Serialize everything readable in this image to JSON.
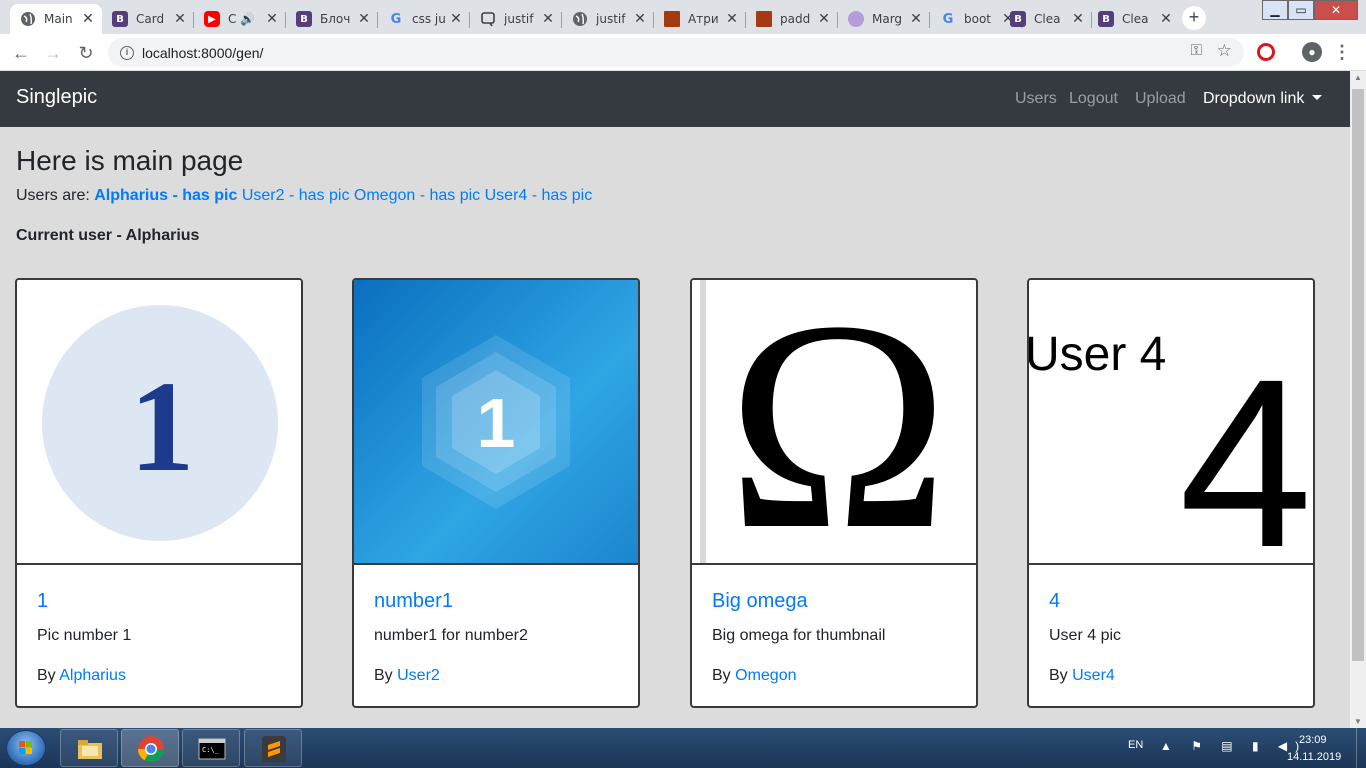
{
  "browser": {
    "tabs": [
      {
        "title": "Main",
        "icon": "globe-icon",
        "active": true
      },
      {
        "title": "Card",
        "icon": "bootstrap-icon"
      },
      {
        "title": "C",
        "icon": "youtube-icon",
        "audio": true
      },
      {
        "title": "Блоч",
        "icon": "bootstrap-icon"
      },
      {
        "title": "css ju",
        "icon": "google-icon"
      },
      {
        "title": "justif",
        "icon": "chat-icon"
      },
      {
        "title": "justif",
        "icon": "globe-icon"
      },
      {
        "title": "Атри",
        "icon": "stack-icon"
      },
      {
        "title": "padd",
        "icon": "stack-icon"
      },
      {
        "title": "Marg",
        "icon": "marg-icon"
      },
      {
        "title": "boot",
        "icon": "google-icon"
      },
      {
        "title": "Clea",
        "icon": "bootstrap-icon"
      },
      {
        "title": "Clea",
        "icon": "bootstrap-icon"
      }
    ],
    "tab_close": "✕",
    "new_tab": "+",
    "url": "localhost:8000/gen/",
    "back": "←",
    "forward": "→",
    "reload": "↻",
    "key_icon": "⚿",
    "star": "☆",
    "menu": "⋮"
  },
  "site": {
    "brand": "Singlepic",
    "nav": {
      "users": "Users",
      "logout": "Logout",
      "upload": "Upload",
      "dropdown": "Dropdown link"
    },
    "title": "Here is main page",
    "users_prefix": "Users are:",
    "users": [
      {
        "label": "Alpharius - has pic",
        "current": true
      },
      {
        "label": "User2 - has pic",
        "current": false
      },
      {
        "label": "Omegon - has pic",
        "current": false
      },
      {
        "label": "User4 - has pic",
        "current": false
      }
    ],
    "current_user": "Current user - Alpharius",
    "cards": [
      {
        "title": "1",
        "text": "Pic number 1",
        "by_label": "By",
        "author": "Alpharius",
        "image_glyph": "1"
      },
      {
        "title": "number1",
        "text": "number1 for number2",
        "by_label": "By",
        "author": "User2",
        "image_glyph": "1"
      },
      {
        "title": "Big omega",
        "text": "Big omega for thumbnail",
        "by_label": "By",
        "author": "Omegon",
        "image_glyph": "Ω"
      },
      {
        "title": "4",
        "text": "User 4 pic",
        "by_label": "By",
        "author": "User4",
        "image_caption": "User 4",
        "image_glyph": "4"
      }
    ]
  },
  "taskbar": {
    "lang": "EN",
    "time": "23:09",
    "date": "14.11.2019",
    "tray": "▲ ⚑ ▤ ▮ ◀)"
  },
  "colors": {
    "navbar": "#343a40",
    "link": "#007bff",
    "page_bg": "#dcdcdc"
  }
}
